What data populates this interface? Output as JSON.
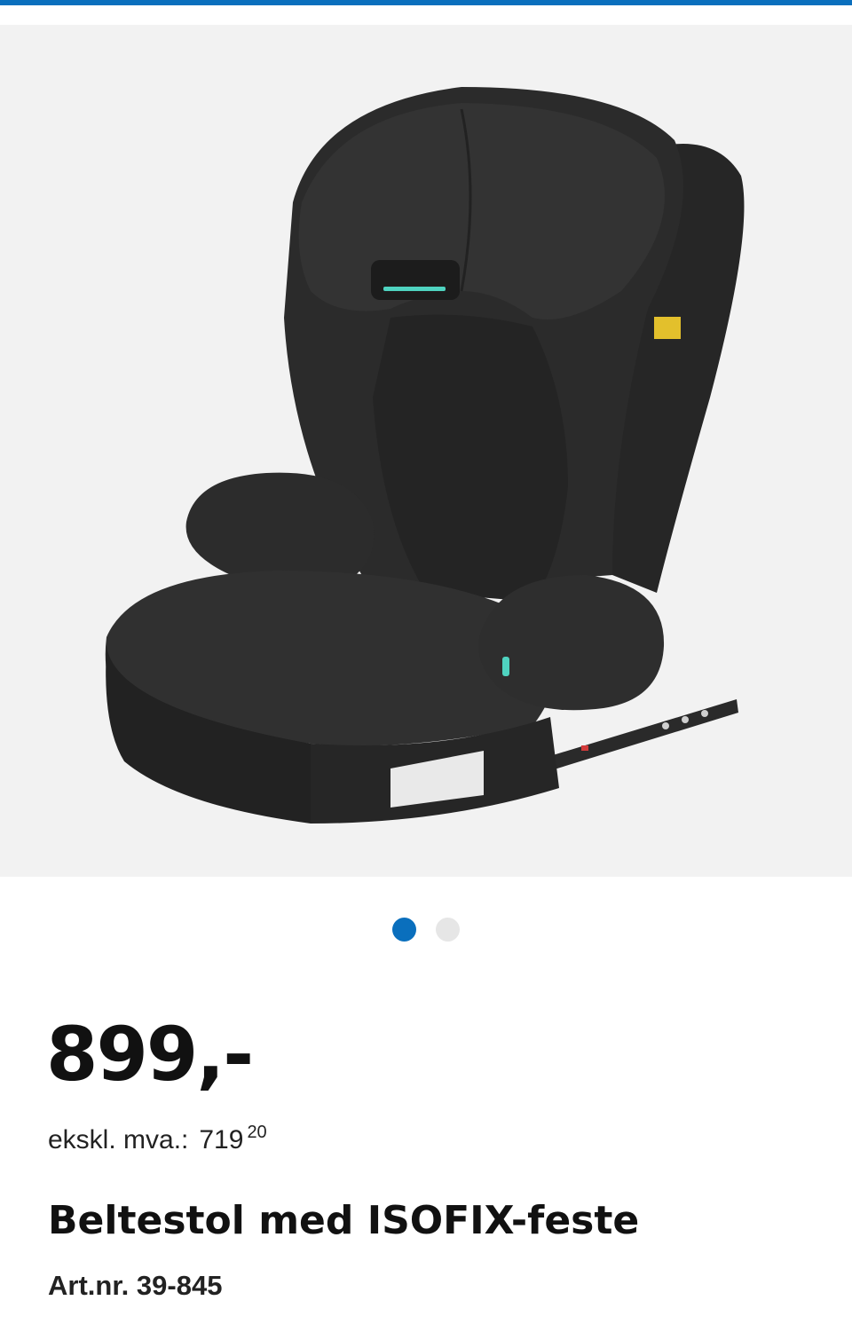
{
  "colors": {
    "accent": "#0a6fbd",
    "image_background": "#f2f2f2",
    "dot_inactive": "#e6e6e6",
    "text": "#111111"
  },
  "gallery": {
    "image_subject": "black booster car seat with ISOFIX connectors",
    "current_index": 1,
    "total": 2
  },
  "product": {
    "price": "899,-",
    "price_ex_vat_label": "ekskl. mva.:",
    "price_ex_vat_main": "719",
    "price_ex_vat_decimals": "20",
    "title": "Beltestol med ISOFIX-feste",
    "article_number": "Art.nr. 39-845"
  }
}
